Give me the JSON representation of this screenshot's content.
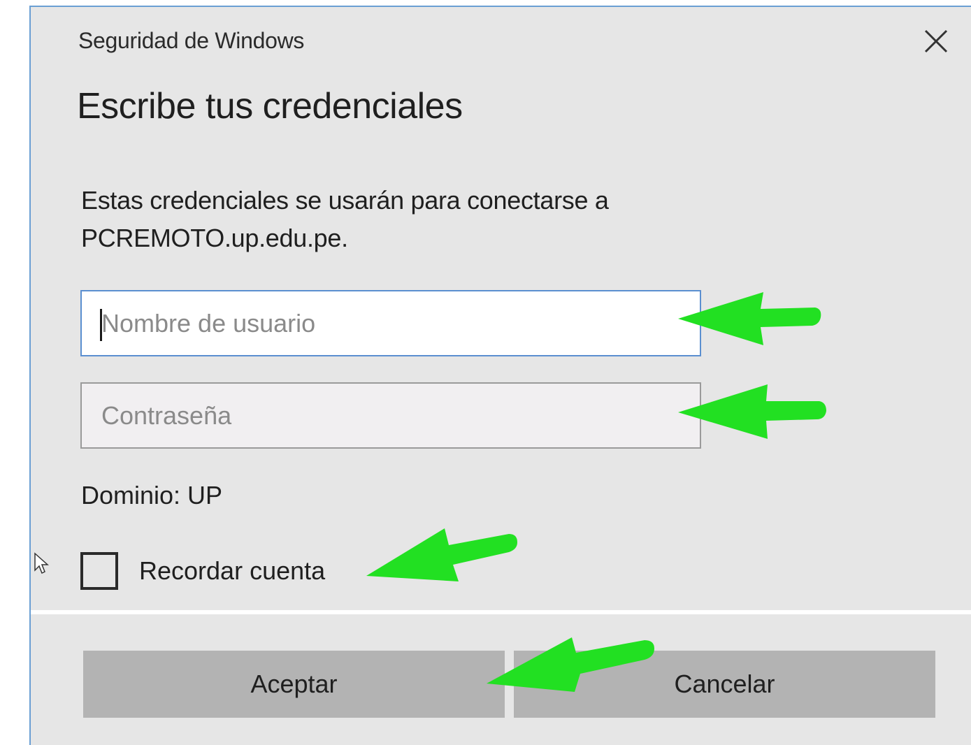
{
  "window": {
    "title": "Seguridad de Windows",
    "close_icon": "close-icon"
  },
  "dialog": {
    "heading": "Escribe tus credenciales",
    "description": "Estas credenciales se usarán para conectarse a PCREMOTO.up.edu.pe.",
    "username_placeholder": "Nombre de usuario",
    "password_placeholder": "Contraseña",
    "domain_label": "Dominio: UP",
    "remember_label": "Recordar cuenta",
    "remember_checked": false
  },
  "buttons": {
    "ok_label": "Aceptar",
    "cancel_label": "Cancelar"
  },
  "annotations": {
    "arrow_color": "#00ee00",
    "arrow_icon": "green-arrow-icon"
  },
  "colors": {
    "dialog_bg": "#e6e6e6",
    "focus_border": "#5b8fd0",
    "button_bg": "#b3b3b3"
  }
}
